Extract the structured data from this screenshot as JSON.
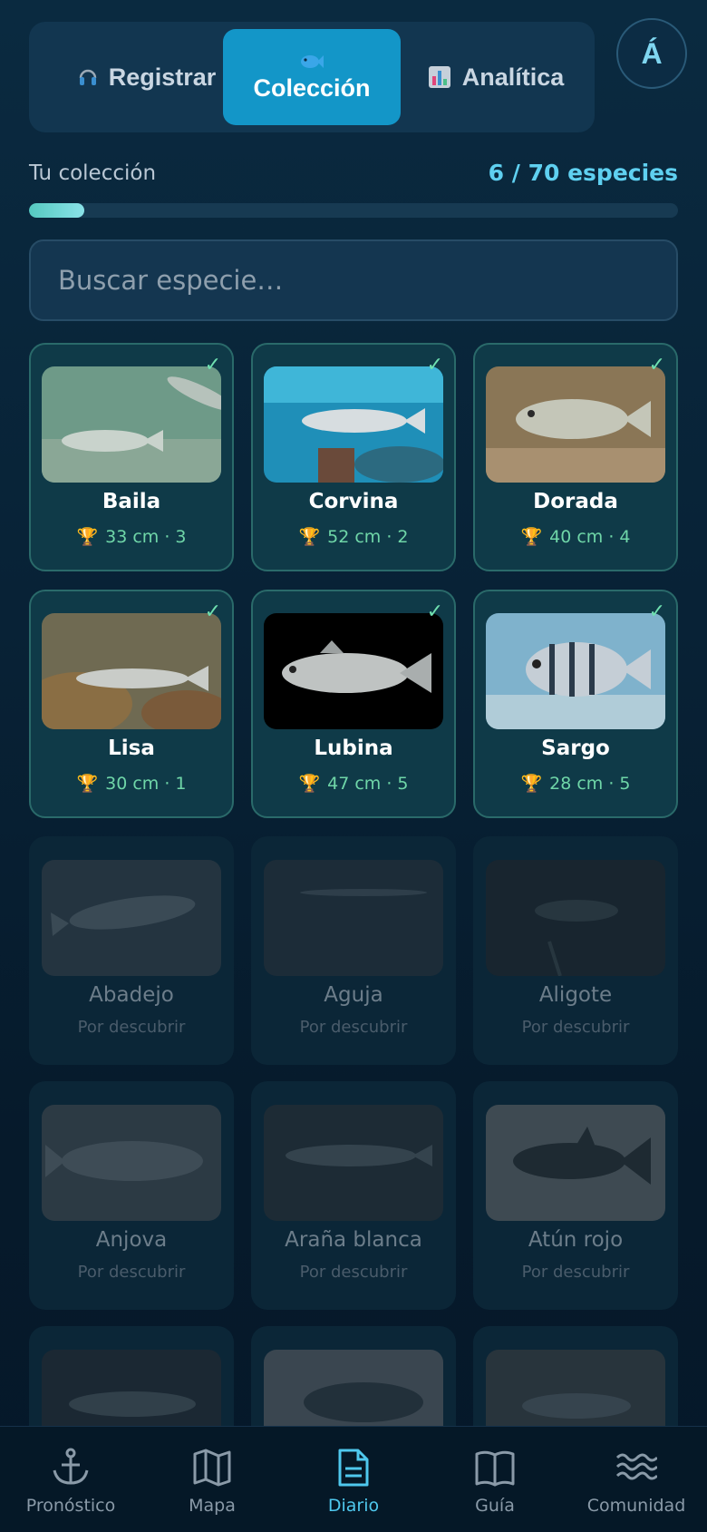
{
  "tabs": {
    "registrar": "Registrar",
    "coleccion": "Colección",
    "analitica": "Analítica"
  },
  "avatar": "Á",
  "collection": {
    "label": "Tu colección",
    "count": "6 / 70 especies",
    "progress_fraction": 0.0857
  },
  "search": {
    "placeholder": "Buscar especie…"
  },
  "caught": [
    {
      "name": "Baila",
      "stat": "33 cm · 3",
      "icon": "trophy-icon"
    },
    {
      "name": "Corvina",
      "stat": "52 cm · 2",
      "icon": "trophy-icon"
    },
    {
      "name": "Dorada",
      "stat": "40 cm · 4",
      "icon": "trophy-icon"
    },
    {
      "name": "Lisa",
      "stat": "30 cm · 1",
      "icon": "trophy-icon"
    },
    {
      "name": "Lubina",
      "stat": "47 cm · 5",
      "icon": "trophy-icon"
    },
    {
      "name": "Sargo",
      "stat": "28 cm · 5",
      "icon": "trophy-icon"
    }
  ],
  "locked": [
    {
      "name": "Abadejo",
      "status": "Por descubrir"
    },
    {
      "name": "Aguja",
      "status": "Por descubrir"
    },
    {
      "name": "Aligote",
      "status": "Por descubrir"
    },
    {
      "name": "Anjova",
      "status": "Por descubrir"
    },
    {
      "name": "Araña blanca",
      "status": "Por descubrir"
    },
    {
      "name": "Atún rojo",
      "status": "Por descubrir"
    }
  ],
  "nav": {
    "items": [
      {
        "label": "Pronóstico",
        "icon": "anchor-icon"
      },
      {
        "label": "Mapa",
        "icon": "map-icon"
      },
      {
        "label": "Diario",
        "icon": "document-icon"
      },
      {
        "label": "Guía",
        "icon": "book-icon"
      },
      {
        "label": "Comunidad",
        "icon": "waves-icon"
      }
    ],
    "active": "Diario"
  },
  "colors": {
    "accent": "#1396c8",
    "count": "#5fd0f0",
    "stat": "#6fd6a8",
    "nav_active": "#4fc8ee"
  }
}
